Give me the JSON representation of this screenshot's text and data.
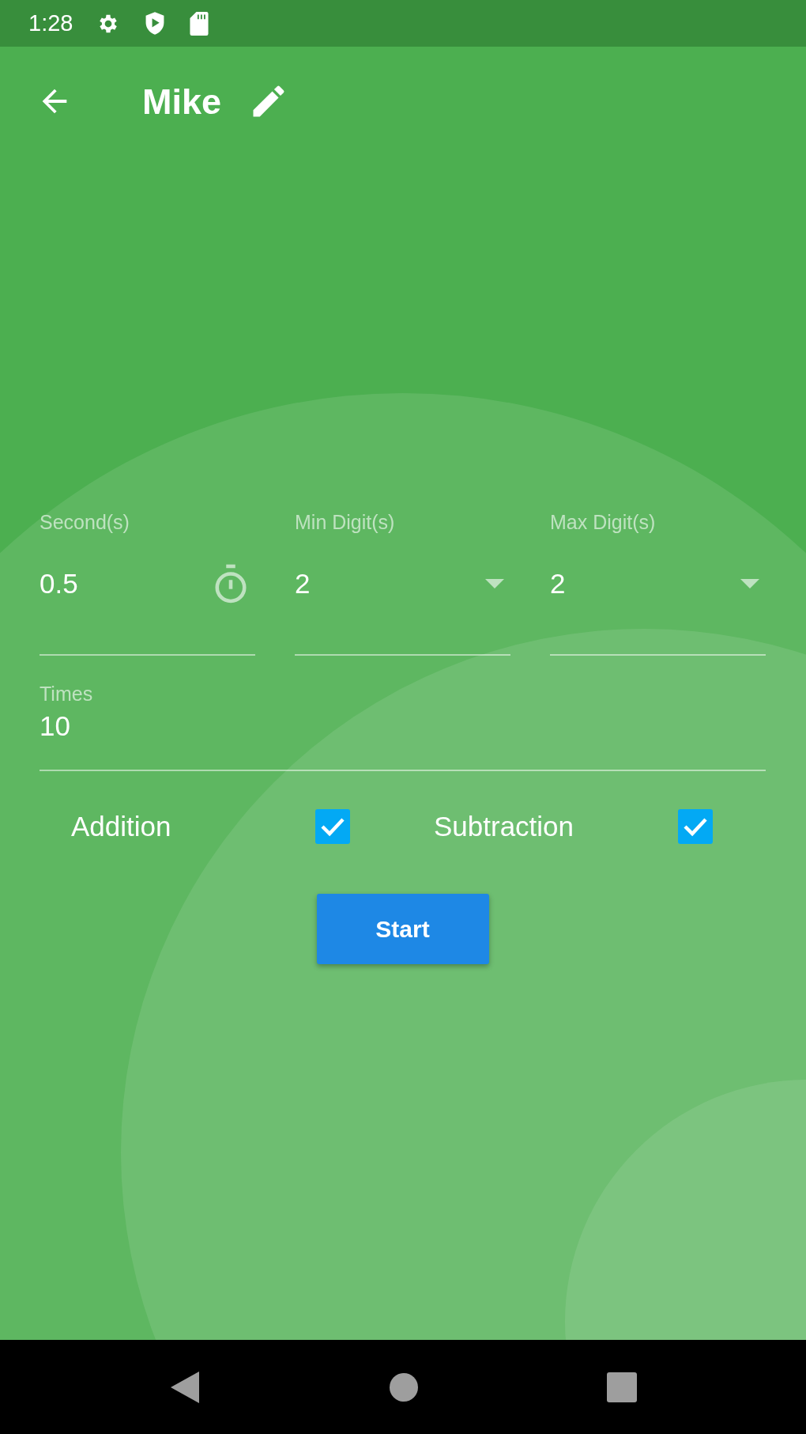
{
  "status_bar": {
    "time": "1:28"
  },
  "app_bar": {
    "title": "Mike"
  },
  "fields": [
    {
      "kind": "timer",
      "label": "Second(s)",
      "value": "0.5"
    },
    {
      "kind": "dropdown",
      "label": "Min Digit(s)",
      "value": "2"
    },
    {
      "kind": "dropdown",
      "label": "Max Digit(s)",
      "value": "2"
    }
  ],
  "times": {
    "label": "Times",
    "value": "10"
  },
  "operations": [
    {
      "label": "Addition",
      "checked": true
    },
    {
      "label": "Subtraction",
      "checked": true
    }
  ],
  "start_button": {
    "label": "Start"
  }
}
